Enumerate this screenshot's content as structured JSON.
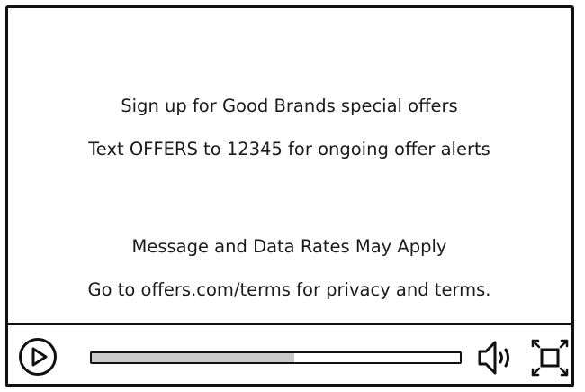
{
  "video": {
    "lines": [
      "Sign up for Good Brands special offers",
      "Text OFFERS to 12345 for ongoing offer alerts",
      "Message and Data Rates May Apply",
      "Go to offers.com/terms for privacy and terms."
    ]
  },
  "controls": {
    "play_icon": "play-icon",
    "volume_icon": "speaker-volume-icon",
    "fullscreen_icon": "fullscreen-icon",
    "progress_fraction": 0.55
  }
}
